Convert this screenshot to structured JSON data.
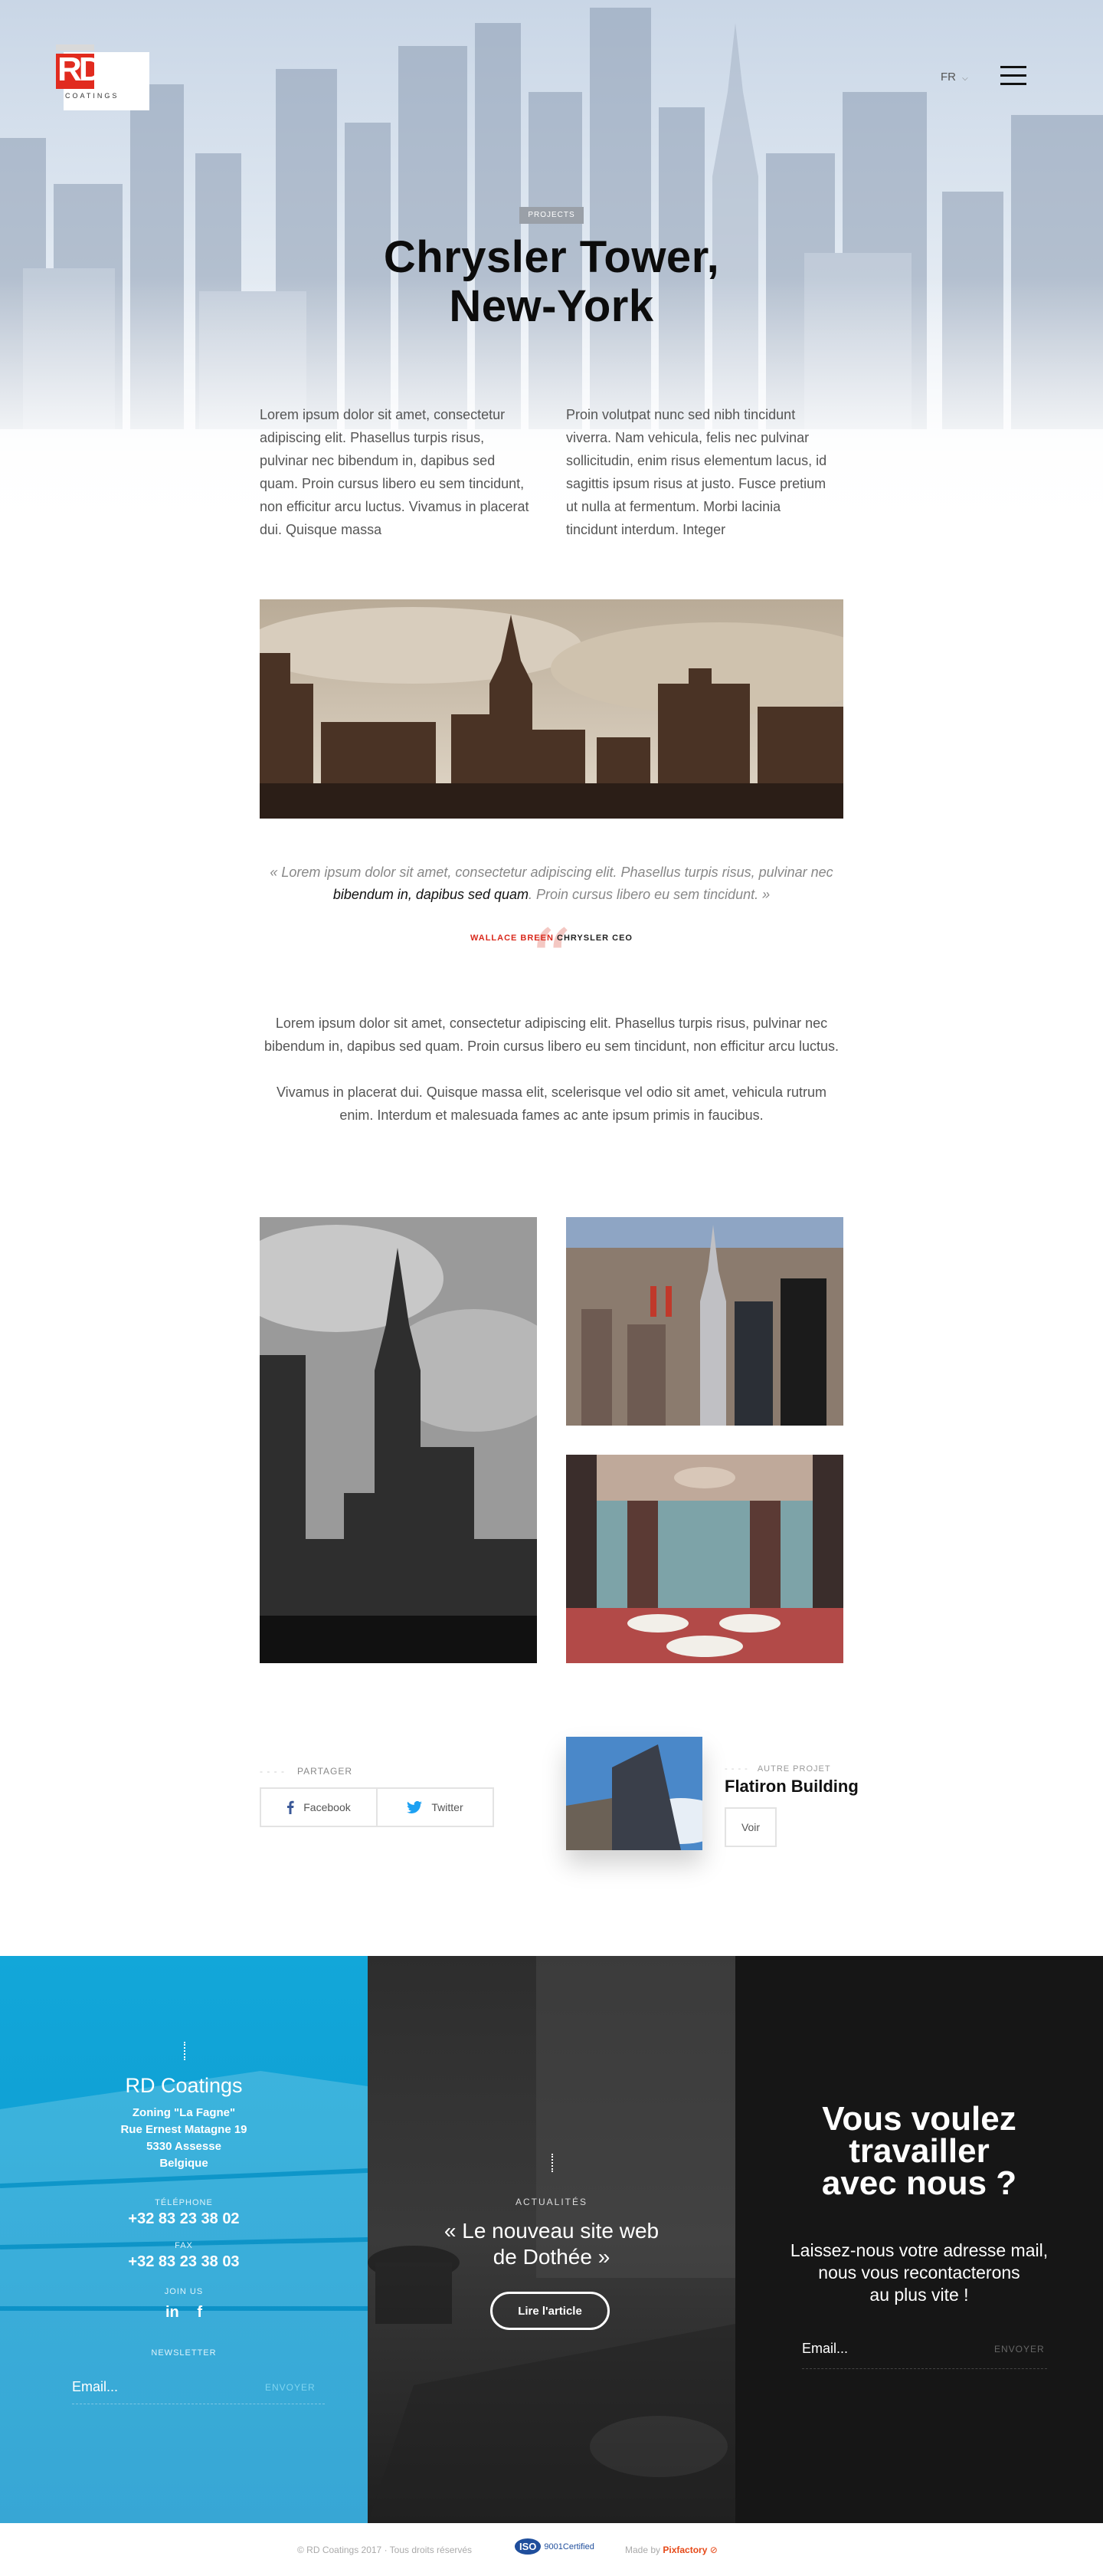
{
  "brand": {
    "logo_letters": "RD",
    "logo_word": "COATINGS"
  },
  "header": {
    "lang": "FR",
    "lang_chevron": "chevron-down-icon",
    "menu_icon": "hamburger-icon"
  },
  "hero": {
    "badge": "PROJECTS",
    "title_line1": "Chrysler Tower,",
    "title_line2": "New-York"
  },
  "intro": {
    "col1": "Lorem ipsum dolor sit amet, consectetur adipiscing elit. Phasellus turpis risus, pulvinar nec bibendum in, dapibus sed quam. Proin cursus libero eu sem tincidunt, non efficitur arcu luctus. Vivamus in placerat dui. Quisque massa",
    "col2": "Proin volutpat nunc sed nibh tincidunt viverra. Nam vehicula, felis nec pulvinar sollicitudin, enim risus elementum lacus, id sagittis ipsum risus at justo. Fusce pretium ut nulla at fermentum. Morbi lacinia tincidunt interdum. Integer"
  },
  "quote": {
    "open": "« Lorem ipsum dolor sit amet, consectetur adipiscing elit. Phasellus turpis risus, pulvinar nec",
    "bold": "bibendum in, dapibus sed quam",
    "close": ". Proin cursus libero eu sem tincidunt. »",
    "author_name": "WALLACE BREEN",
    "author_role": "CHRYSLER CEO"
  },
  "body": {
    "p1": "Lorem ipsum dolor sit amet, consectetur adipiscing elit. Phasellus turpis risus, pulvinar nec bibendum in, dapibus sed quam. Proin cursus libero eu sem tincidunt, non efficitur arcu luctus.",
    "p2": "Vivamus in placerat dui. Quisque massa elit, scelerisque vel odio sit amet, vehicula rutrum enim. Interdum et malesuada fames ac ante ipsum primis in faucibus."
  },
  "share": {
    "label": "PARTAGER",
    "facebook": "Facebook",
    "twitter": "Twitter"
  },
  "other_project": {
    "label": "AUTRE PROJET",
    "title": "Flatiron Building",
    "button": "Voir"
  },
  "footer_contact": {
    "name": "RD Coatings",
    "address": [
      "Zoning \"La Fagne\"",
      "Rue Ernest Matagne 19",
      "5330 Assesse",
      "Belgique"
    ],
    "phone_label": "TÉLÉPHONE",
    "phone": "+32 83 23 38 02",
    "fax_label": "FAX",
    "fax": "+32 83 23 38 03",
    "join_label": "JOIN US",
    "newsletter_label": "NEWSLETTER",
    "newsletter_placeholder": "Email...",
    "newsletter_send": "ENVOYER"
  },
  "news": {
    "category": "ACTUALITÉS",
    "title_line1": "« Le nouveau site web",
    "title_line2": "de Dothée »",
    "button": "Lire l'article"
  },
  "cta": {
    "title_line1": "Vous voulez",
    "title_line2": "travailler",
    "title_line3": "avec nous ?",
    "sub_line1": "Laissez-nous votre adresse mail,",
    "sub_line2": "nous vous recontacterons",
    "sub_line3": "au plus vite !",
    "email_placeholder": "Email...",
    "send": "ENVOYER"
  },
  "bottom": {
    "copyright": "© RD Coatings 2017 · Tous droits réservés",
    "iso_mark": "ISO",
    "iso_text": "9001Certified",
    "made_by": "Made by",
    "maker": "Pixfactory"
  },
  "colors": {
    "accent_red": "#d9291c",
    "blue": "#12a7d9",
    "dark": "#161616"
  }
}
